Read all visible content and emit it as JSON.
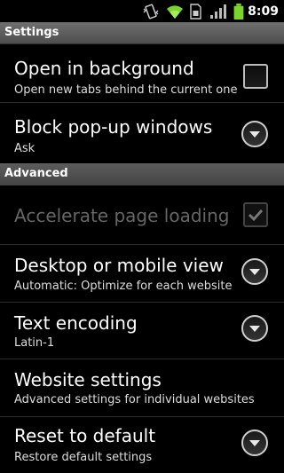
{
  "status_bar": {
    "time": "8:09",
    "icons": [
      "vibrate-icon",
      "wifi-icon",
      "sim-icon",
      "signal-icon",
      "battery-icon"
    ]
  },
  "title": "Settings",
  "colors": {
    "background": "#000000",
    "title_bar": "#5a5a5a",
    "section_header": "#4e4e4e",
    "text_primary": "#ffffff",
    "text_summary": "#dddddd",
    "text_disabled": "#666666",
    "battery": "#7bd32c",
    "wifi": "#7bd32c"
  },
  "rows": [
    {
      "title": "Open in background",
      "summary": "Open new tabs behind the current one",
      "control": "checkbox",
      "checked": false,
      "enabled": true
    },
    {
      "title": "Block pop-up windows",
      "summary": "Ask",
      "control": "dropdown",
      "enabled": true
    }
  ],
  "section": {
    "label": "Advanced"
  },
  "advanced_rows": [
    {
      "title": "Accelerate page loading",
      "summary": "",
      "control": "checkbox",
      "checked": true,
      "enabled": false
    },
    {
      "title": "Desktop or mobile view",
      "summary": "Automatic: Optimize for each website",
      "control": "dropdown",
      "enabled": true
    },
    {
      "title": "Text encoding",
      "summary": "Latin-1",
      "control": "dropdown",
      "enabled": true
    },
    {
      "title": "Website settings",
      "summary": "Advanced settings for individual websites",
      "control": "none",
      "enabled": true
    },
    {
      "title": "Reset to default",
      "summary": "Restore default settings",
      "control": "dropdown",
      "enabled": true
    }
  ]
}
